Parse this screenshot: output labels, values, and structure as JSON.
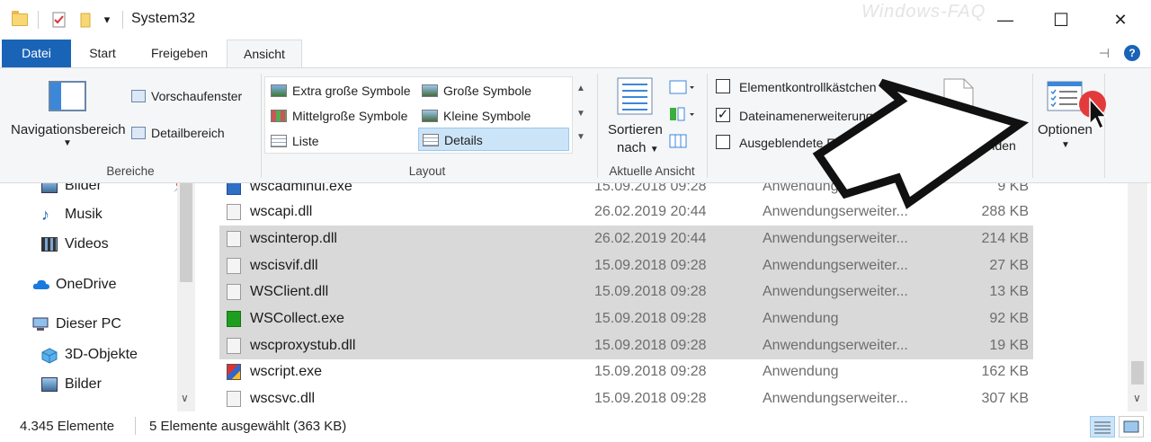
{
  "window": {
    "title": "System32",
    "watermark": "Windows-FAQ",
    "minimize_glyph": "—",
    "maximize_glyph": "☐",
    "close_glyph": "✕",
    "qa_dropdown_glyph": "▾"
  },
  "tabs": [
    {
      "label": "Datei"
    },
    {
      "label": "Start"
    },
    {
      "label": "Freigeben"
    },
    {
      "label": "Ansicht"
    }
  ],
  "tab_extras": {
    "pin_glyph": "⊣",
    "help_glyph": "?"
  },
  "ribbon": {
    "bereiche": {
      "nav_pane": "Navigationsbereich",
      "preview_pane": "Vorschaufenster",
      "details_pane": "Detailbereich",
      "label": "Bereiche"
    },
    "layout": {
      "items": [
        "Extra große Symbole",
        "Große Symbole",
        "Mittelgroße Symbole",
        "Kleine Symbole",
        "Liste",
        "Details"
      ],
      "selected": "Details",
      "label": "Layout"
    },
    "current_view": {
      "sort_line1": "Sortieren",
      "sort_line2": "nach",
      "label": "Aktuelle Ansicht"
    },
    "show_hide": {
      "checkbox1": "Elementkontrollkästchen",
      "checkbox2": "Dateinamenerweiterungen",
      "checkbox3": "Ausgeblendete Elemente",
      "checkbox1_checked": false,
      "checkbox2_checked": true,
      "checkbox3_checked": false,
      "hide_selected": "blenden"
    },
    "options": {
      "label": "Optionen"
    }
  },
  "nav": {
    "items": [
      {
        "label": "Bilder",
        "icon": "pictures-icon"
      },
      {
        "label": "Musik",
        "icon": "music-icon"
      },
      {
        "label": "Videos",
        "icon": "videos-icon"
      },
      {
        "label": "OneDrive",
        "icon": "cloud-icon"
      },
      {
        "label": "Dieser PC",
        "icon": "computer-icon"
      },
      {
        "label": "3D-Objekte",
        "icon": "cube-icon"
      },
      {
        "label": "Bilder",
        "icon": "pictures-icon"
      }
    ]
  },
  "files": [
    {
      "name": "wscadminui.exe",
      "date": "15.09.2018 09:28",
      "type": "Anwendung",
      "size": "9 KB",
      "selected": false,
      "icon": "exe-blue"
    },
    {
      "name": "wscapi.dll",
      "date": "26.02.2019 20:44",
      "type": "Anwendungserweiter...",
      "size": "288 KB",
      "selected": false,
      "icon": "dll"
    },
    {
      "name": "wscinterop.dll",
      "date": "26.02.2019 20:44",
      "type": "Anwendungserweiter...",
      "size": "214 KB",
      "selected": true,
      "icon": "dll"
    },
    {
      "name": "wscisvif.dll",
      "date": "15.09.2018 09:28",
      "type": "Anwendungserweiter...",
      "size": "27 KB",
      "selected": true,
      "icon": "dll"
    },
    {
      "name": "WSClient.dll",
      "date": "15.09.2018 09:28",
      "type": "Anwendungserweiter...",
      "size": "13 KB",
      "selected": true,
      "icon": "dll"
    },
    {
      "name": "WSCollect.exe",
      "date": "15.09.2018 09:28",
      "type": "Anwendung",
      "size": "92 KB",
      "selected": true,
      "icon": "exe-green"
    },
    {
      "name": "wscproxystub.dll",
      "date": "15.09.2018 09:28",
      "type": "Anwendungserweiter...",
      "size": "19 KB",
      "selected": true,
      "icon": "dll"
    },
    {
      "name": "wscript.exe",
      "date": "15.09.2018 09:28",
      "type": "Anwendung",
      "size": "162 KB",
      "selected": false,
      "icon": "exe-color"
    },
    {
      "name": "wscsvc.dll",
      "date": "15.09.2018 09:28",
      "type": "Anwendungserweiter...",
      "size": "307 KB",
      "selected": false,
      "icon": "dll"
    }
  ],
  "status": {
    "count": "4.345 Elemente",
    "selection": "5 Elemente ausgewählt (363 KB)"
  },
  "colors": {
    "file_tab": "#1a64b8",
    "selection_row": "#d9d9d9",
    "ribbon_bg": "#f5f6f7",
    "layout_selected": "#cce4f7",
    "cursor_dot": "#e33b3b"
  }
}
